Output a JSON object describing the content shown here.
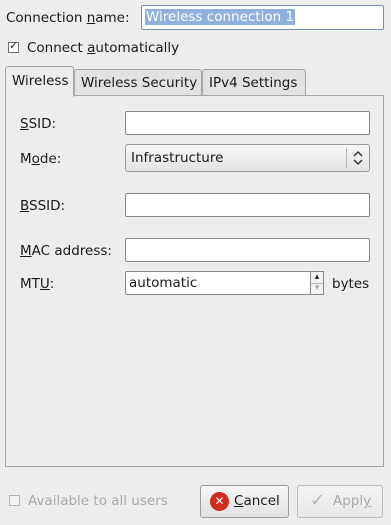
{
  "connection_name": {
    "label_pre": "Connection ",
    "label_ul": "n",
    "label_post": "ame:",
    "value": "Wireless connection 1"
  },
  "connect_auto": {
    "checked": true,
    "check_glyph": "✓",
    "label_pre": "Connect ",
    "label_ul": "a",
    "label_post": "utomatically"
  },
  "tabs": [
    {
      "label": "Wireless",
      "active": true
    },
    {
      "label": "Wireless Security",
      "active": false
    },
    {
      "label": "IPv4 Settings",
      "active": false
    }
  ],
  "wireless": {
    "ssid": {
      "label_ul": "S",
      "label_post": "SID:",
      "value": ""
    },
    "mode": {
      "label_pre": "M",
      "label_ul": "o",
      "label_post": "de:",
      "value": "Infrastructure",
      "arrow_glyph": "⌃⌄"
    },
    "bssid": {
      "label_ul": "B",
      "label_post": "SSID:",
      "value": ""
    },
    "mac": {
      "label_ul": "M",
      "label_post": "AC address:",
      "value": ""
    },
    "mtu": {
      "label_pre": "MT",
      "label_ul": "U",
      "label_post": ":",
      "value": "automatic",
      "unit": "bytes",
      "up_glyph": "▴",
      "down_glyph": "▾"
    }
  },
  "footer": {
    "available_all_users": {
      "checked": false,
      "label": "Available to all users"
    },
    "cancel": {
      "label_ul": "C",
      "label_post": "ancel",
      "icon": "cancel-icon",
      "icon_glyph": "✕"
    },
    "apply": {
      "label_pre": "Appl",
      "label_ul": "y",
      "label_post": "",
      "icon": "checkmark-icon",
      "icon_glyph": "✓"
    }
  },
  "colors": {
    "selection_bg": "#8fb1dc",
    "cancel_icon_red": "#d12a1f"
  }
}
